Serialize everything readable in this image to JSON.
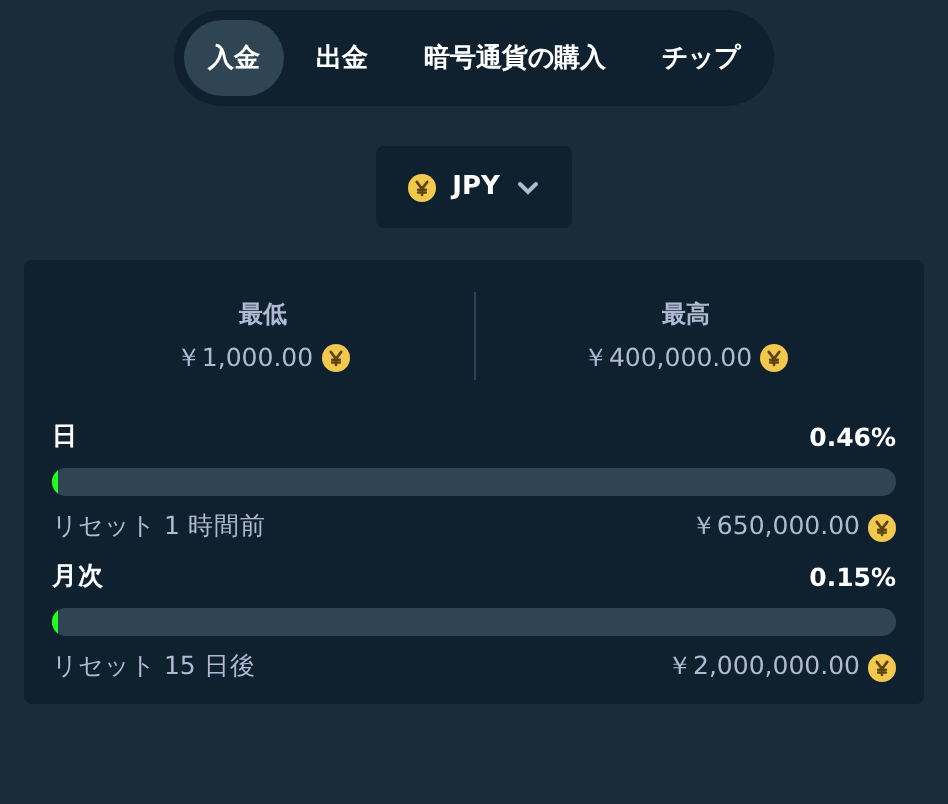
{
  "tabs": [
    {
      "label": "入金",
      "selected": true
    },
    {
      "label": "出金",
      "selected": false
    },
    {
      "label": "暗号通貨の購入",
      "selected": false
    },
    {
      "label": "チップ",
      "selected": false
    }
  ],
  "currency": {
    "code": "JPY"
  },
  "limits": [
    {
      "label": "最低",
      "amount": "￥1,000.00"
    },
    {
      "label": "最高",
      "amount": "￥400,000.00"
    }
  ],
  "periods": [
    {
      "name": "日",
      "percent": "0.46%",
      "level": 0.0046,
      "reset": "リセット 1 時間前",
      "amount": "￥650,000.00"
    },
    {
      "name": "月次",
      "percent": "0.15%",
      "level": 0.0015,
      "reset": "リセット 15 日後",
      "amount": "￥2,000,000.00"
    }
  ]
}
